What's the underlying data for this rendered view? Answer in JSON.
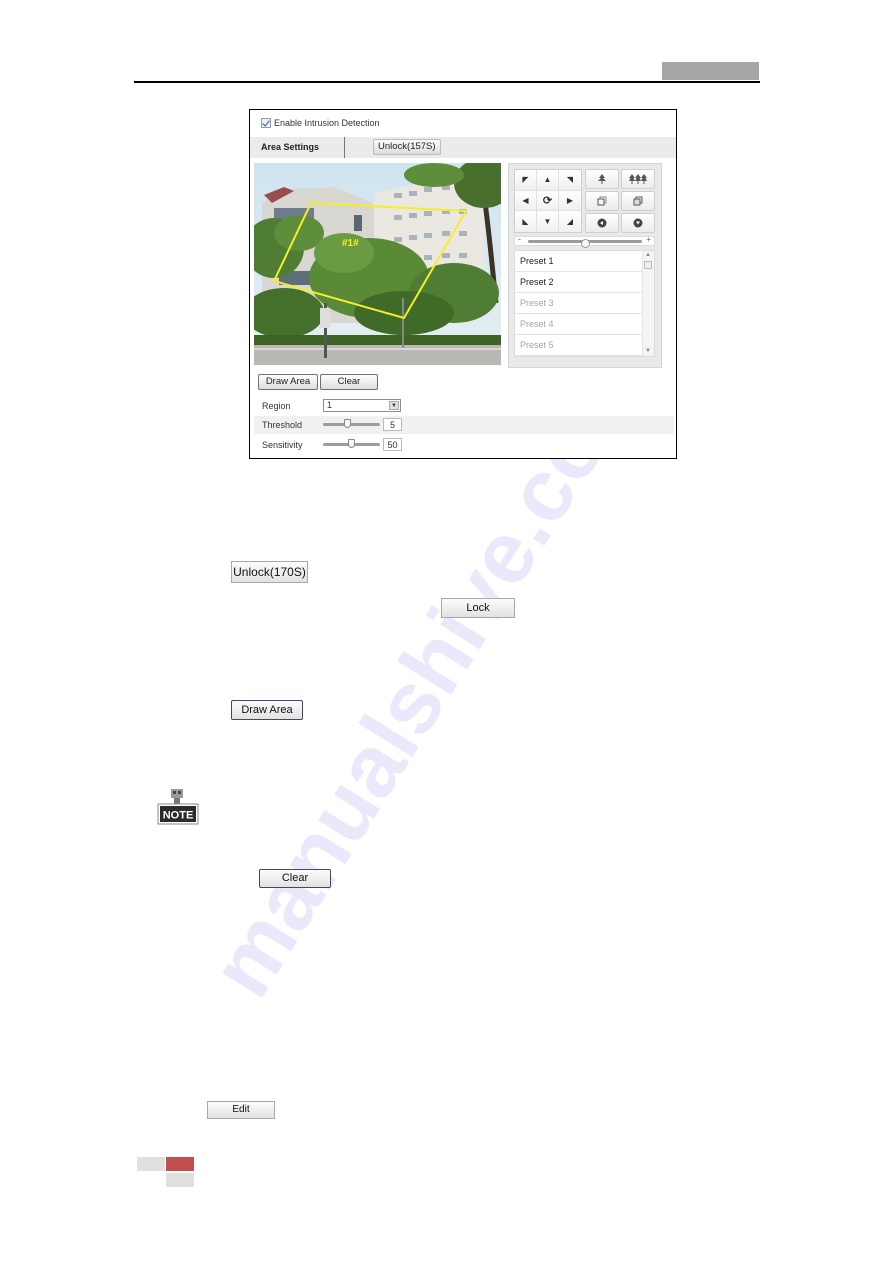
{
  "page": {
    "watermark": "manualshive.com"
  },
  "figure": {
    "enable_checkbox": {
      "label": "Enable Intrusion Detection",
      "checked": true
    },
    "tabs": [
      {
        "label": "Area Settings",
        "active": true
      }
    ],
    "unlock_button": "Unlock(157S)",
    "video": {
      "region_label": "#1#",
      "region_color": "#f5ef2a"
    },
    "ptz": {
      "direction_buttons": [
        {
          "icon": "arrow-up-left-icon",
          "glyph": "◤"
        },
        {
          "icon": "arrow-up-icon",
          "glyph": "▲"
        },
        {
          "icon": "arrow-up-right-icon",
          "glyph": "◥"
        },
        {
          "icon": "arrow-left-icon",
          "glyph": "◀"
        },
        {
          "icon": "auto-pan-icon",
          "glyph": "⟳"
        },
        {
          "icon": "arrow-right-icon",
          "glyph": "▶"
        },
        {
          "icon": "arrow-down-left-icon",
          "glyph": "◣"
        },
        {
          "icon": "arrow-down-icon",
          "glyph": "▼"
        },
        {
          "icon": "arrow-down-right-icon",
          "glyph": "◢"
        }
      ],
      "function_buttons": [
        {
          "icon": "zoom-in-icon",
          "glyph": "⍋"
        },
        {
          "icon": "zoom-out-icon",
          "glyph": "⩩"
        },
        {
          "icon": "focus-near-icon",
          "glyph": "❐"
        },
        {
          "icon": "focus-far-icon",
          "glyph": "❒"
        },
        {
          "icon": "iris-open-icon",
          "glyph": "●"
        },
        {
          "icon": "iris-close-icon",
          "glyph": "●"
        }
      ],
      "speed_slider": {
        "min_label": "-",
        "max_label": "+",
        "value_fraction": 0.5
      },
      "presets": [
        {
          "label": "Preset 1",
          "state": "active"
        },
        {
          "label": "Preset 2",
          "state": "active"
        },
        {
          "label": "Preset 3",
          "state": "inactive"
        },
        {
          "label": "Preset 4",
          "state": "inactive"
        },
        {
          "label": "Preset 5",
          "state": "inactive"
        }
      ]
    },
    "draw_area_button": "Draw Area",
    "clear_button": "Clear",
    "region": {
      "label": "Region",
      "value": "1"
    },
    "threshold": {
      "label": "Threshold",
      "value": "5",
      "slider_fraction": 0.42
    },
    "sensitivity": {
      "label": "Sensitivity",
      "value": "50",
      "slider_fraction": 0.5
    }
  },
  "body_buttons": {
    "unlock": "Unlock(170S)",
    "lock": "Lock",
    "draw_area": "Draw Area",
    "note": "NOTE",
    "clear": "Clear",
    "edit": "Edit"
  },
  "colors": {
    "header_tab": "#a6a6a6",
    "footer_accent": "#c0504d",
    "footer_gray": "#e0e0e0"
  }
}
